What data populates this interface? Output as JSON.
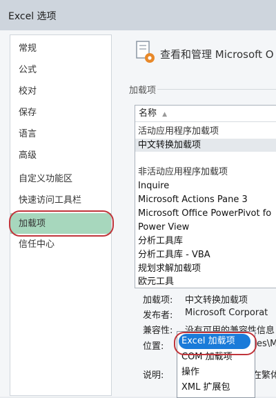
{
  "window": {
    "title": "Excel 选项"
  },
  "sidebar": {
    "items": [
      "常规",
      "公式",
      "校对",
      "保存",
      "语言",
      "高级",
      "自定义功能区",
      "快速访问工具栏",
      "加载项",
      "信任中心"
    ],
    "selected": "加载项"
  },
  "header": {
    "title": "查看和管理 Microsoft O"
  },
  "section": {
    "label": "加载项"
  },
  "addins": {
    "column_name": "名称",
    "rows": [
      {
        "text": "活动应用程序加载项",
        "group": true
      },
      {
        "text": "中文转换加载项",
        "group": false
      },
      {
        "text": "",
        "group": false
      },
      {
        "text": "非活动应用程序加载项",
        "group": true
      },
      {
        "text": "Inquire",
        "group": false
      },
      {
        "text": "Microsoft Actions Pane 3",
        "group": false
      },
      {
        "text": "Microsoft Office PowerPivot fo",
        "group": false
      },
      {
        "text": "Power View",
        "group": false
      },
      {
        "text": "分析工具库",
        "group": false
      },
      {
        "text": "分析工具库 - VBA",
        "group": false
      },
      {
        "text": "规划求解加载项",
        "group": false
      },
      {
        "text": "欧元工具",
        "group": false
      }
    ]
  },
  "details": {
    "addin_label": "加载项:",
    "addin_value": "中文转换加载项",
    "publisher_label": "发布者:",
    "publisher_value": "Microsoft Corporat",
    "compat_label": "兼容性:",
    "compat_value": "没有可用的兼容性信息",
    "location_label": "位置:",
    "location_value": "es\\M",
    "desc_label": "说明:",
    "desc_value": "在繁体"
  },
  "manage_dropdown": {
    "options": [
      "Excel 加载项",
      "COM 加载项",
      "操作",
      "XML 扩展包"
    ],
    "selected": "Excel 加载项"
  },
  "colors": {
    "accent_blue": "#1a7bd9",
    "highlight_green": "#a7d7bd",
    "annotation_red": "#c0343a"
  }
}
